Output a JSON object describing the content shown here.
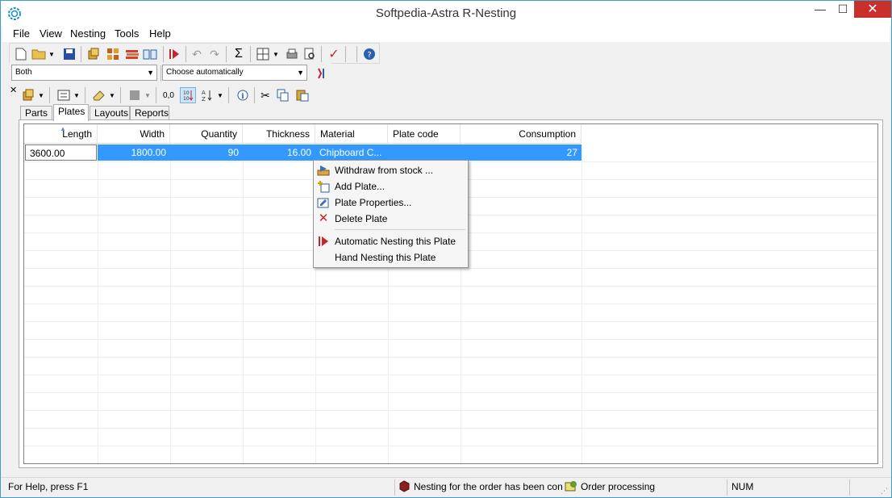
{
  "window": {
    "title": "Softpedia-Astra R-Nesting",
    "minimize_glyph": "—",
    "maximize_glyph": "☐",
    "close_glyph": "✕"
  },
  "menubar": {
    "items": [
      "File",
      "View",
      "Nesting",
      "Tools",
      "Help"
    ]
  },
  "toolbar2": {
    "filter_value": "Both",
    "mode_value": "Choose automatically"
  },
  "toolbar3": {
    "decimal_label": "0,0"
  },
  "tabs": [
    {
      "label": "Parts",
      "active": false
    },
    {
      "label": "Plates",
      "active": true
    },
    {
      "label": "Layouts",
      "active": false
    },
    {
      "label": "Reports",
      "active": false
    }
  ],
  "grid": {
    "columns": [
      "Length",
      "Width",
      "Quantity",
      "Thickness",
      "Material",
      "Plate code",
      "Consumption"
    ],
    "rows": [
      {
        "length": "3600.00",
        "width": "1800.00",
        "quantity": "90",
        "thickness": "16.00",
        "material": "Chipboard C...",
        "plate_code": "",
        "consumption": "27"
      }
    ]
  },
  "context_menu": {
    "items": [
      {
        "label": "Withdraw from stock ...",
        "icon": "withdraw-stock-icon"
      },
      {
        "label": "Add Plate...",
        "icon": "add-plate-icon"
      },
      {
        "label": "Plate Properties...",
        "icon": "plate-properties-icon"
      },
      {
        "label": "Delete Plate",
        "icon": "delete-icon"
      },
      {
        "label": "Automatic Nesting this Plate",
        "icon": "auto-nesting-icon"
      },
      {
        "label": "Hand Nesting this Plate",
        "icon": ""
      }
    ]
  },
  "statusbar": {
    "help_text": "For Help, press F1",
    "nesting_text": "Nesting for the order has been con",
    "order_text": "Order processing",
    "num_text": "NUM"
  },
  "colors": {
    "selection": "#3399ff",
    "close_button": "#c7302b",
    "accent_red": "#c0282d"
  }
}
